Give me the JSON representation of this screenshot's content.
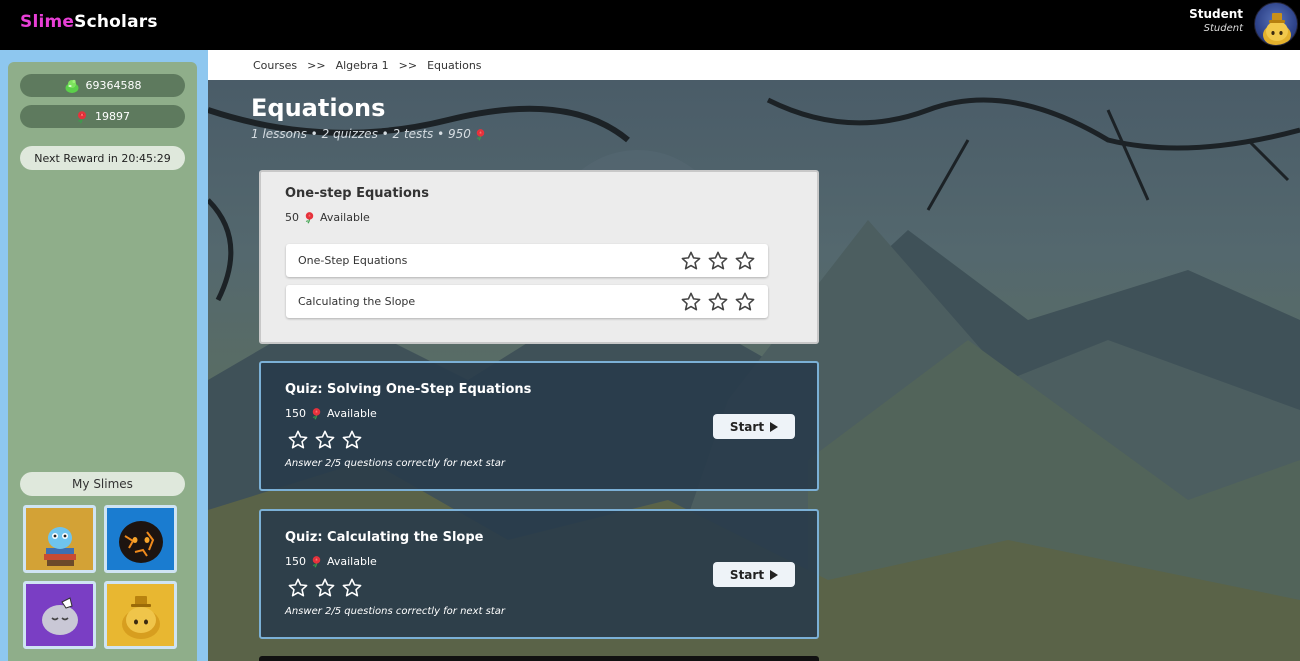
{
  "header": {
    "logo_part1": "Slime",
    "logo_part2": "Scholars",
    "user_name": "Student",
    "user_role": "Student"
  },
  "sidebar": {
    "coins": "69364588",
    "roses": "19897",
    "next_reward": "Next Reward in 20:45:29",
    "my_slimes_label": "My Slimes",
    "slimes": [
      {
        "name": "book-slime-icon"
      },
      {
        "name": "lava-slime-icon"
      },
      {
        "name": "ghost-slime-icon"
      },
      {
        "name": "gold-slime-icon"
      }
    ]
  },
  "breadcrumb": {
    "items": [
      "Courses",
      "Algebra 1",
      "Equations"
    ],
    "separator": ">>"
  },
  "page": {
    "title": "Equations",
    "subtitle": "1 lessons • 2 quizzes • 2 tests • 950"
  },
  "lesson": {
    "title": "One-step Equations",
    "available_count": "50",
    "available_label": "Available",
    "items": [
      {
        "label": "One-Step Equations",
        "stars": 0
      },
      {
        "label": "Calculating the Slope",
        "stars": 0
      }
    ]
  },
  "quizzes": [
    {
      "title": "Quiz: Solving One-Step Equations",
      "available_count": "150",
      "available_label": "Available",
      "stars": 0,
      "hint": "Answer 2/5 questions correctly for next star",
      "start_label": "Start"
    },
    {
      "title": "Quiz: Calculating the Slope",
      "available_count": "150",
      "available_label": "Available",
      "stars": 0,
      "hint": "Answer 2/5 questions correctly for next star",
      "start_label": "Start"
    }
  ],
  "colors": {
    "brand_pink": "#e83fd6",
    "sidebar_blue": "#8ec7ef",
    "sidebar_green": "#8fae8a",
    "quiz_border": "#7bb0d6"
  }
}
